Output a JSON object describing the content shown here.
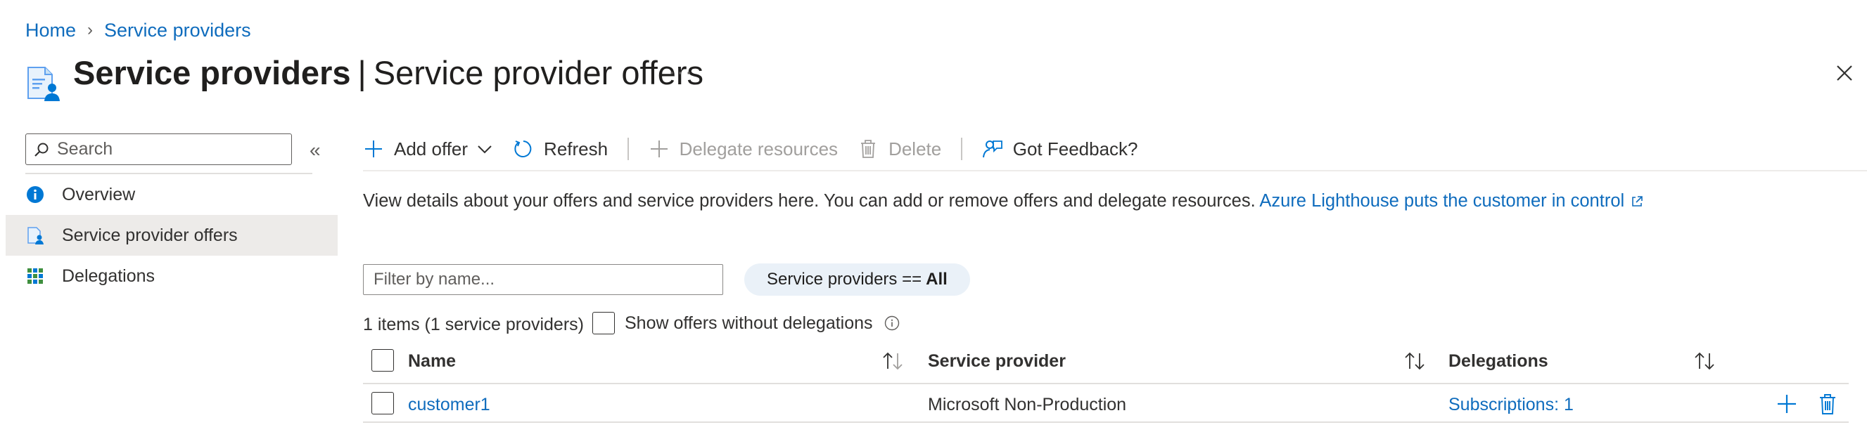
{
  "breadcrumb": {
    "home": "Home",
    "current": "Service providers",
    "separator": "›"
  },
  "header": {
    "title_strong": "Service providers",
    "title_bar": "|",
    "title_rest": "Service provider offers",
    "more": "···"
  },
  "sidebar": {
    "search_placeholder": "Search",
    "collapse": "«",
    "items": [
      {
        "label": "Overview",
        "icon": "info-icon",
        "selected": false
      },
      {
        "label": "Service provider offers",
        "icon": "service-provider-offers-icon",
        "selected": true
      },
      {
        "label": "Delegations",
        "icon": "delegations-grid-icon",
        "selected": false
      }
    ]
  },
  "toolbar": {
    "add_offer": "Add offer",
    "refresh": "Refresh",
    "delegate_resources": "Delegate resources",
    "delete": "Delete",
    "feedback": "Got Feedback?"
  },
  "description": {
    "text": "View details about your offers and service providers here. You can add or remove offers and delegate resources.",
    "link": "Azure Lighthouse puts the customer in control"
  },
  "filters": {
    "filter_placeholder": "Filter by name...",
    "pill_label": "Service providers ==",
    "pill_value": "All"
  },
  "summary": {
    "items_count": "1 items (1 service providers)",
    "show_offers_label": "Show offers without delegations"
  },
  "table": {
    "columns": [
      "Name",
      "Service provider",
      "Delegations"
    ],
    "rows": [
      {
        "name": "customer1",
        "service_provider": "Microsoft Non-Production",
        "delegations": "Subscriptions: 1"
      }
    ]
  },
  "colors": {
    "link": "#0f6cbd",
    "selected_nav": "#edebe9",
    "pill_bg": "#eaf1f8",
    "text": "#323130",
    "disabled": "#a19f9d"
  }
}
